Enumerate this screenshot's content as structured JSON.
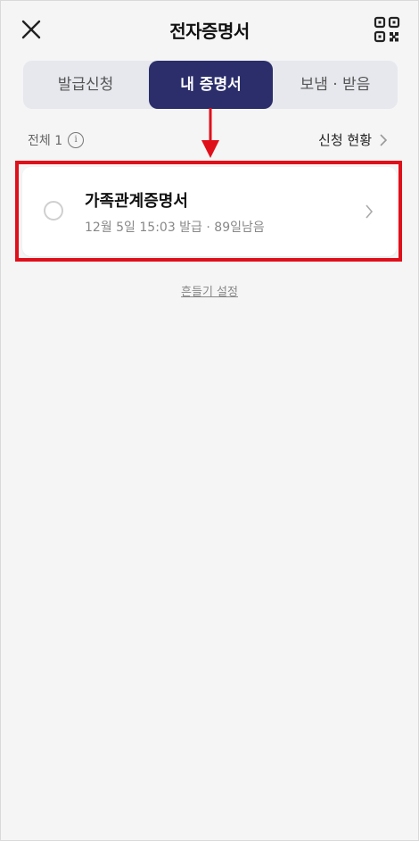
{
  "header": {
    "title": "전자증명서"
  },
  "tabs": [
    {
      "label": "발급신청"
    },
    {
      "label": "내 증명서"
    },
    {
      "label": "보냄 · 받음"
    }
  ],
  "summary": {
    "count_label": "전체 1",
    "info_glyph": "i",
    "status_link": "신청 현황"
  },
  "certificate": {
    "title": "가족관계증명서",
    "subtitle": "12월 5일 15:03 발급 · 89일남음"
  },
  "footer": {
    "shake_setting": "흔들기 설정"
  },
  "colors": {
    "accent": "#2b2e6b",
    "highlight": "#e0101b",
    "background": "#f5f5f5"
  }
}
